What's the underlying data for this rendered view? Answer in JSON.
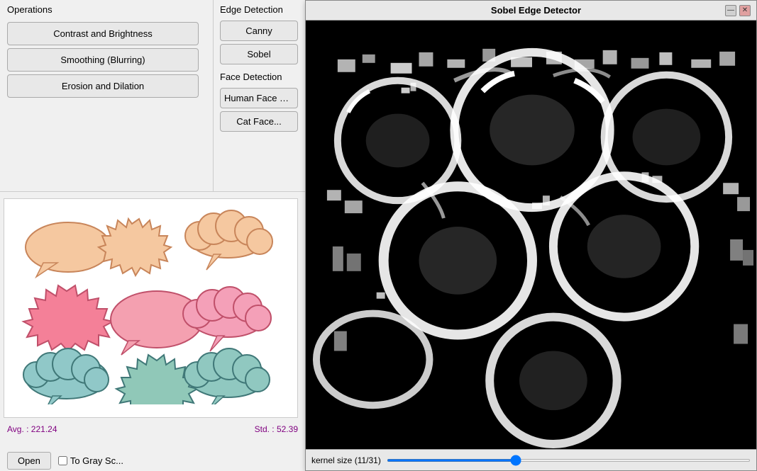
{
  "app": {
    "title": "Operations"
  },
  "left_panel": {
    "operations_label": "Operations",
    "buttons": [
      {
        "id": "contrast-brightness",
        "label": "Contrast and Brightness"
      },
      {
        "id": "smoothing",
        "label": "Smoothing (Blurring)"
      },
      {
        "id": "erosion-dilation",
        "label": "Erosion and Dilation"
      }
    ],
    "edge_detection": {
      "label": "Edge Detection",
      "buttons": [
        {
          "id": "canny",
          "label": "Canny"
        },
        {
          "id": "sobel",
          "label": "Sobel"
        }
      ]
    },
    "face_detection": {
      "label": "Face Detection",
      "buttons": [
        {
          "id": "human-face",
          "label": "Human Face an..."
        },
        {
          "id": "cat-face",
          "label": "Cat Face..."
        }
      ]
    },
    "stats": {
      "avg_label": "Avg. : 221.24",
      "std_label": "Std. : 52.39"
    },
    "bottom": {
      "open_label": "Open",
      "checkbox_label": "To Gray Sc..."
    }
  },
  "sobel_window": {
    "title": "Sobel Edge Detector",
    "controls": {
      "minimize": "—",
      "close": "✕"
    },
    "slider": {
      "label": "kernel size (11/31)",
      "value": 35,
      "min": 0,
      "max": 100
    }
  }
}
